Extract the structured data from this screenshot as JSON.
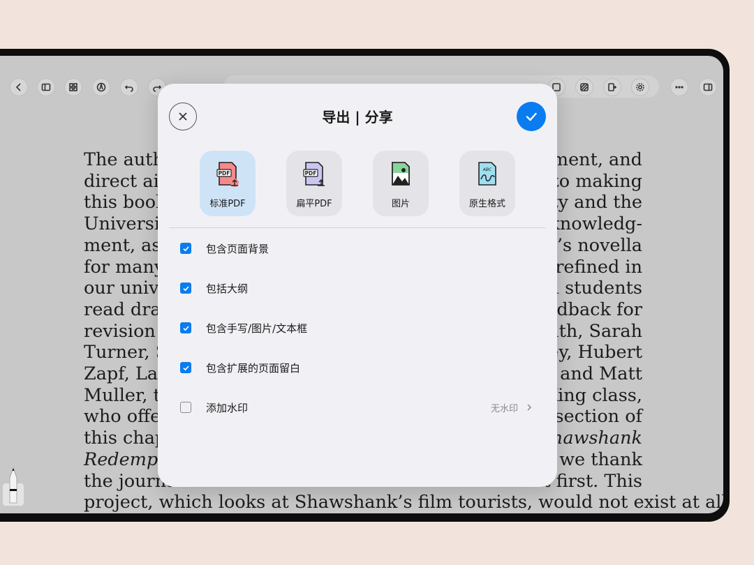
{
  "colors": {
    "background": "#f2e4dc",
    "accent": "#0a7cf0",
    "selected_tile": "#cfe3f7"
  },
  "toolbar": {
    "icons": [
      "chevron-left-icon",
      "sidebar-icon",
      "grid-icon",
      "pen-icon",
      "undo-icon",
      "redo-icon",
      "layers-icon",
      "stripes-icon",
      "insert-page-icon",
      "gear-icon",
      "more-icon",
      "panel-icon"
    ]
  },
  "document": {
    "lines": [
      {
        "left": "The autho",
        "right": "ment, and"
      },
      {
        "left": "direct aid c",
        "right": "to making"
      },
      {
        "left": "this book p",
        "right": "ity and the"
      },
      {
        "left": "University",
        "right": "knowledg-"
      },
      {
        "left": "ment, as w",
        "right": "g’s novella"
      },
      {
        "left": "for many y",
        "right": "refined in"
      },
      {
        "left": "our univer",
        "right": "d students"
      },
      {
        "left": "read draft",
        "right": "edback for"
      },
      {
        "left": "revision ar",
        "right": "ruth, Sarah"
      },
      {
        "left": "Turner, Sa",
        "right": "ey, Hubert"
      },
      {
        "left": "Zapf, Larr",
        "right": "n and Matt"
      },
      {
        "left": "Muller, tw",
        "right": "King class,"
      },
      {
        "left": "who offere",
        "right": "section of"
      },
      {
        "left": "this chapte",
        "right": "Shawshank"
      },
      {
        "left": "Redemptio",
        "right": "; we thank"
      },
      {
        "left": "the journa",
        "right": "it first. This"
      },
      {
        "full": "project, which looks at Shawshank’s film tourists, would not exist at all"
      }
    ]
  },
  "dialog": {
    "title": "导出 | 分享",
    "close_icon": "close-icon",
    "confirm_icon": "checkmark-icon",
    "formats": [
      {
        "label": "标准PDF",
        "icon": "pdf-export-icon",
        "selected": true
      },
      {
        "label": "扁平PDF",
        "icon": "pdf-flat-export-icon",
        "selected": false
      },
      {
        "label": "图片",
        "icon": "image-icon",
        "selected": false
      },
      {
        "label": "原生格式",
        "icon": "native-format-icon",
        "selected": false
      }
    ],
    "options": [
      {
        "label": "包含页面背景",
        "checked": true
      },
      {
        "label": "包括大纲",
        "checked": true
      },
      {
        "label": "包含手写/图片/文本框",
        "checked": true
      },
      {
        "label": "包含扩展的页面留白",
        "checked": true
      },
      {
        "label": "添加水印",
        "checked": false,
        "value": "无水印"
      }
    ]
  }
}
